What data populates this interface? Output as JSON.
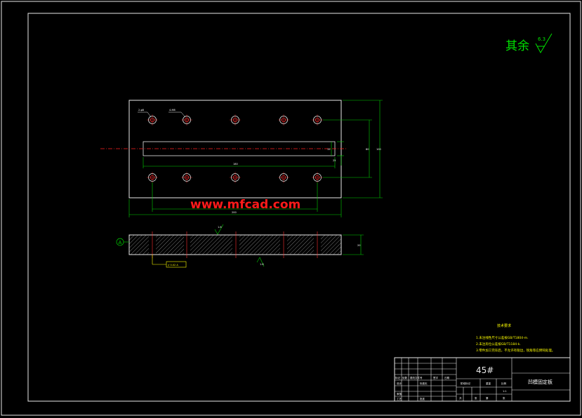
{
  "surface_finish": {
    "label": "其余",
    "value": "6.3"
  },
  "watermark": "www.mfcad.com",
  "datum_label": "A",
  "part_material": "45#",
  "part_name": "凹模固定板",
  "tech_req": {
    "title": "技术要求",
    "lines": [
      "1.未注线性尺寸公差按GB/T1804-m.",
      "2.未注形位公差按GB/T1184-k.",
      "3.零件加工完毕后，不允许有锐边，锐角等应倒钝处理。"
    ]
  },
  "plan_labels": {
    "hole_callout_left": "2-φ8",
    "hole_callout_right": "4-M8",
    "dim_slot_length": "180",
    "dim_overall_length": "200",
    "dim_height_inner": "80",
    "dim_height_outer": "100",
    "dim_slot_width": "15",
    "dim_slot_offset": "25"
  },
  "section_labels": {
    "roughness_top": "1.6",
    "roughness_bottom": "1.6",
    "tolerance_frame": "// 0.02 A",
    "dim_thickness": "20"
  },
  "title_block": {
    "r1": [
      "标记",
      "处数",
      "更改文件号",
      "签字",
      "日期"
    ],
    "r2": [
      "设计",
      "",
      "标准化",
      "",
      ""
    ],
    "r3": [
      "审核",
      "",
      "",
      "",
      ""
    ],
    "r4": [
      "工艺",
      "",
      "批准",
      "",
      ""
    ],
    "stage_headers": [
      "阶段标记",
      "重量",
      "比例"
    ],
    "stage_values": [
      "",
      "",
      "1:1"
    ],
    "sheet_info": [
      "共",
      "张",
      "第",
      "张"
    ]
  }
}
